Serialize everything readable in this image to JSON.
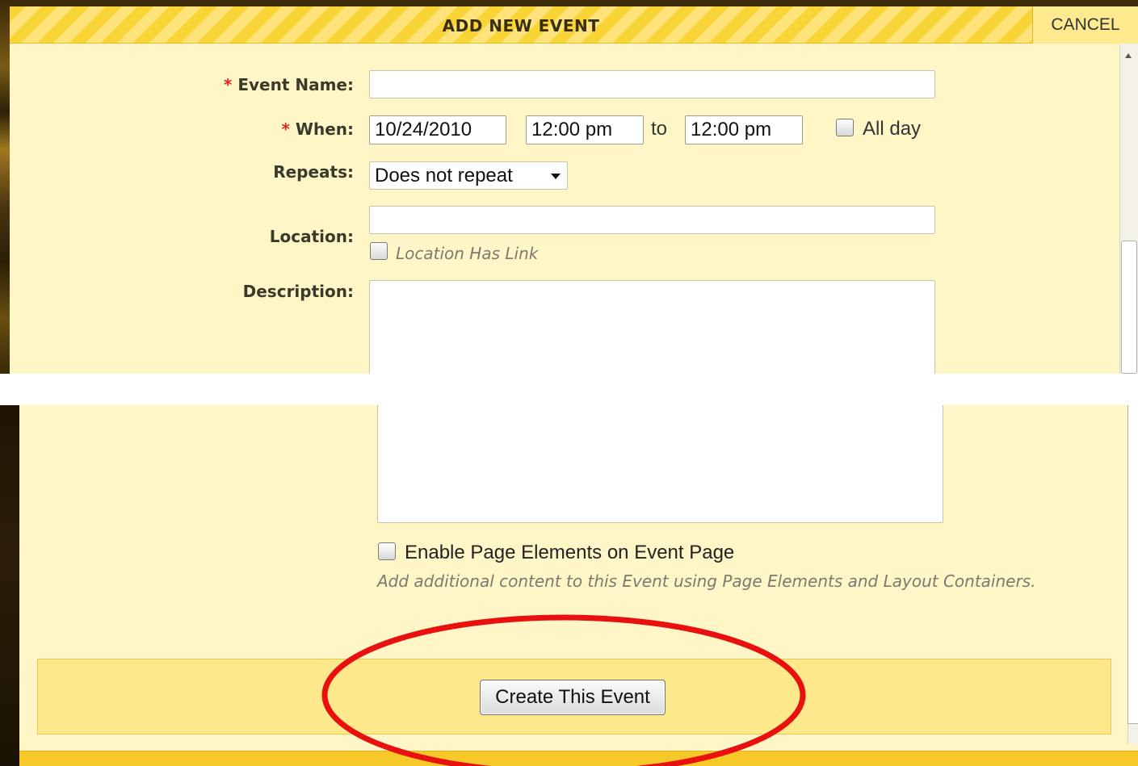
{
  "dialog": {
    "title": "ADD NEW EVENT",
    "cancel_label": "CANCEL"
  },
  "form": {
    "required_marker": "*",
    "event_name": {
      "label": "Event Name:",
      "value": ""
    },
    "when": {
      "label": "When:",
      "date": "10/24/2010",
      "start_time": "12:00 pm",
      "to_label": "to",
      "end_time": "12:00 pm",
      "all_day_label": "All day",
      "all_day_checked": false
    },
    "repeats": {
      "label": "Repeats:",
      "selected": "Does not repeat"
    },
    "location": {
      "label": "Location:",
      "value": "",
      "has_link_label": "Location Has Link",
      "has_link_checked": false
    },
    "description": {
      "label": "Description:",
      "value": ""
    },
    "page_elements": {
      "label": "Enable Page Elements on Event Page",
      "checked": false,
      "hint": "Add additional content to this Event using Page Elements and Layout Containers."
    }
  },
  "footer": {
    "create_label": "Create This Event"
  },
  "annotation": {
    "type": "ellipse",
    "color": "#e8110f",
    "target": "create-this-event-button"
  }
}
